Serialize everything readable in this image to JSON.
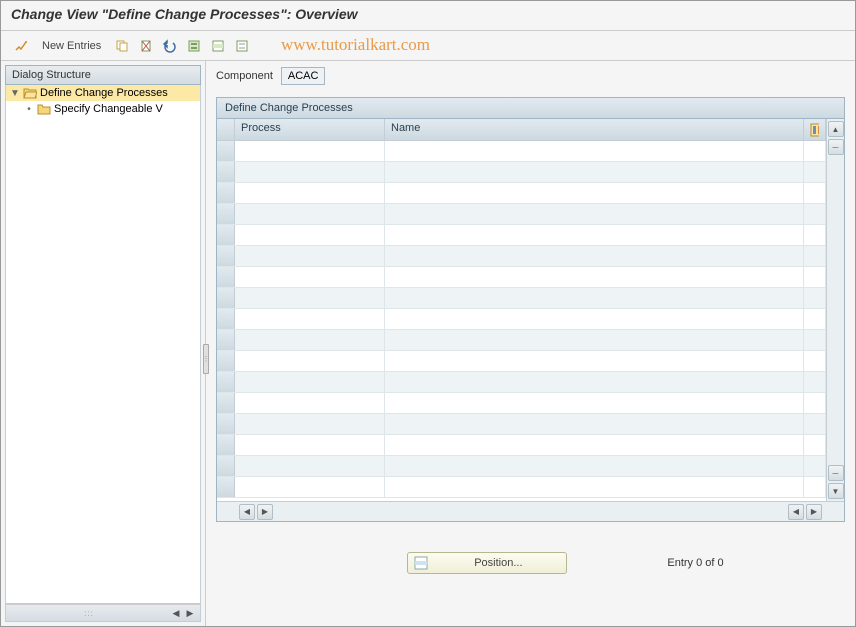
{
  "header": {
    "title": "Change View \"Define Change Processes\": Overview"
  },
  "watermark": "www.tutorialkart.com",
  "toolbar": {
    "new_entries_label": "New Entries"
  },
  "sidebar": {
    "header": "Dialog Structure",
    "items": [
      {
        "label": "Define Change Processes"
      },
      {
        "label": "Specify Changeable V"
      }
    ]
  },
  "main": {
    "component_label": "Component",
    "component_value": "ACAC",
    "table": {
      "title": "Define Change Processes",
      "columns": {
        "process": "Process",
        "name": "Name"
      },
      "rows": []
    },
    "position_label": "Position...",
    "entry_status": "Entry 0 of 0"
  }
}
